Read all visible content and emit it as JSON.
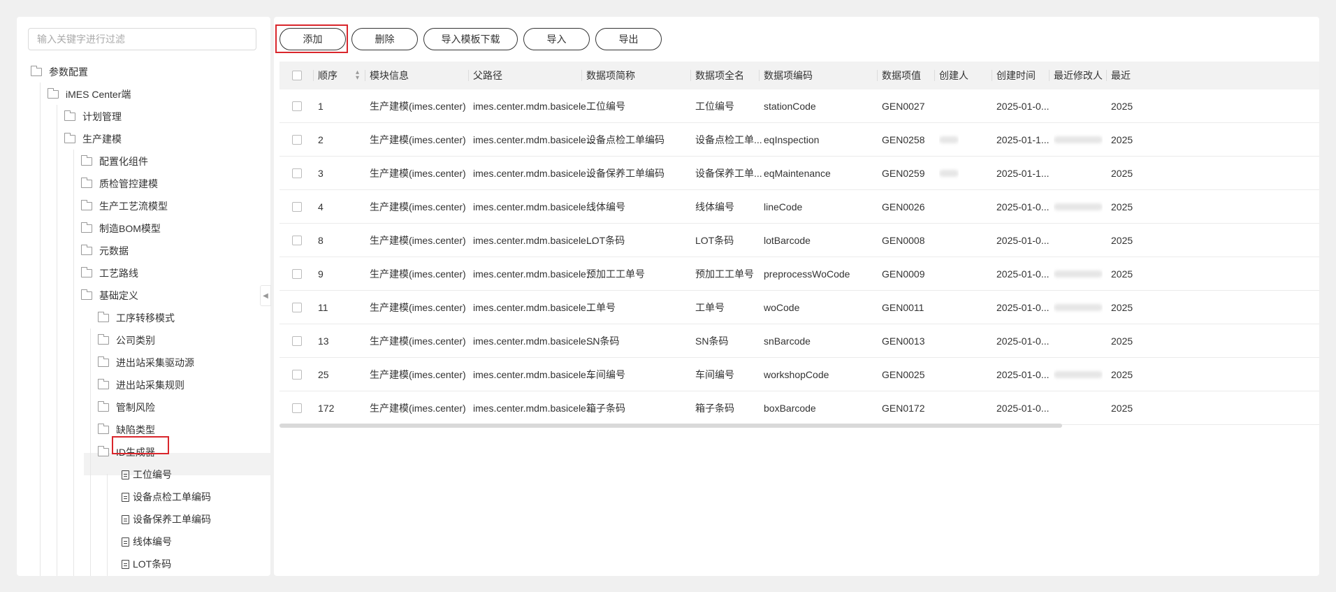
{
  "filter": {
    "placeholder": "输入关键字进行过滤"
  },
  "tree": [
    {
      "label": "参数配置",
      "icon": "folder-icon",
      "depth": 0
    },
    {
      "label": "iMES Center端",
      "icon": "folder-icon",
      "depth": 1
    },
    {
      "label": "计划管理",
      "icon": "folder-icon",
      "depth": 2
    },
    {
      "label": "生产建模",
      "icon": "folder-icon",
      "depth": 2
    },
    {
      "label": "配置化组件",
      "icon": "folder-icon",
      "depth": 3
    },
    {
      "label": "质检管控建模",
      "icon": "folder-icon",
      "depth": 3
    },
    {
      "label": "生产工艺流模型",
      "icon": "folder-icon",
      "depth": 3
    },
    {
      "label": "制造BOM模型",
      "icon": "folder-icon",
      "depth": 3
    },
    {
      "label": "元数据",
      "icon": "folder-icon",
      "depth": 3
    },
    {
      "label": "工艺路线",
      "icon": "folder-icon",
      "depth": 3
    },
    {
      "label": "基础定义",
      "icon": "folder-icon",
      "depth": 3
    },
    {
      "label": "工序转移模式",
      "icon": "folder-icon",
      "depth": 4
    },
    {
      "label": "公司类别",
      "icon": "folder-icon",
      "depth": 4
    },
    {
      "label": "进出站采集驱动源",
      "icon": "folder-icon",
      "depth": 4
    },
    {
      "label": "进出站采集规则",
      "icon": "folder-icon",
      "depth": 4
    },
    {
      "label": "管制风险",
      "icon": "folder-icon",
      "depth": 4
    },
    {
      "label": "缺陷类型",
      "icon": "folder-icon",
      "depth": 4
    },
    {
      "label": "ID生成器",
      "icon": "folder-icon",
      "depth": 4
    },
    {
      "label": "工位编号",
      "icon": "document-icon",
      "depth": 5
    },
    {
      "label": "设备点检工单编码",
      "icon": "document-icon",
      "depth": 5
    },
    {
      "label": "设备保养工单编码",
      "icon": "document-icon",
      "depth": 5
    },
    {
      "label": "线体编号",
      "icon": "document-icon",
      "depth": 5
    },
    {
      "label": "LOT条码",
      "icon": "document-icon",
      "depth": 5
    }
  ],
  "toolbar": {
    "add": "添加",
    "delete": "删除",
    "template": "导入模板下载",
    "import": "导入",
    "export": "导出"
  },
  "columns": [
    "顺序",
    "模块信息",
    "父路径",
    "数据项简称",
    "数据项全名",
    "数据项编码",
    "数据项值",
    "创建人",
    "创建时间",
    "最近修改人",
    "最近"
  ],
  "rows": [
    {
      "order": "1",
      "module": "生产建模(imes.center)",
      "path": "imes.center.mdm.basicele...",
      "short": "工位编号",
      "full": "工位编号",
      "code": "stationCode",
      "value": "GEN0027",
      "creator": "",
      "created": "2025-01-0...",
      "modifier": "",
      "modified": "2025"
    },
    {
      "order": "2",
      "module": "生产建模(imes.center)",
      "path": "imes.center.mdm.basicele...",
      "short": "设备点检工单编码",
      "full": "设备点检工单...",
      "code": "eqInspection",
      "value": "GEN0258",
      "creator": "blurred",
      "created": "2025-01-1...",
      "modifier": "blurred",
      "modified": "2025"
    },
    {
      "order": "3",
      "module": "生产建模(imes.center)",
      "path": "imes.center.mdm.basicele...",
      "short": "设备保养工单编码",
      "full": "设备保养工单...",
      "code": "eqMaintenance",
      "value": "GEN0259",
      "creator": "blurred",
      "created": "2025-01-1...",
      "modifier": "",
      "modified": "2025"
    },
    {
      "order": "4",
      "module": "生产建模(imes.center)",
      "path": "imes.center.mdm.basicele...",
      "short": "线体编号",
      "full": "线体编号",
      "code": "lineCode",
      "value": "GEN0026",
      "creator": "",
      "created": "2025-01-0...",
      "modifier": "blurred",
      "modified": "2025"
    },
    {
      "order": "8",
      "module": "生产建模(imes.center)",
      "path": "imes.center.mdm.basicele...",
      "short": "LOT条码",
      "full": "LOT条码",
      "code": "lotBarcode",
      "value": "GEN0008",
      "creator": "",
      "created": "2025-01-0...",
      "modifier": "",
      "modified": "2025"
    },
    {
      "order": "9",
      "module": "生产建模(imes.center)",
      "path": "imes.center.mdm.basicele...",
      "short": "预加工工单号",
      "full": "预加工工单号",
      "code": "preprocessWoCode",
      "value": "GEN0009",
      "creator": "",
      "created": "2025-01-0...",
      "modifier": "blurred",
      "modified": "2025"
    },
    {
      "order": "11",
      "module": "生产建模(imes.center)",
      "path": "imes.center.mdm.basicele...",
      "short": "工单号",
      "full": "工单号",
      "code": "woCode",
      "value": "GEN0011",
      "creator": "",
      "created": "2025-01-0...",
      "modifier": "blurred",
      "modified": "2025"
    },
    {
      "order": "13",
      "module": "生产建模(imes.center)",
      "path": "imes.center.mdm.basicele...",
      "short": "SN条码",
      "full": "SN条码",
      "code": "snBarcode",
      "value": "GEN0013",
      "creator": "",
      "created": "2025-01-0...",
      "modifier": "",
      "modified": "2025"
    },
    {
      "order": "25",
      "module": "生产建模(imes.center)",
      "path": "imes.center.mdm.basicele...",
      "short": "车间编号",
      "full": "车间编号",
      "code": "workshopCode",
      "value": "GEN0025",
      "creator": "",
      "created": "2025-01-0...",
      "modifier": "blurred",
      "modified": "2025"
    },
    {
      "order": "172",
      "module": "生产建模(imes.center)",
      "path": "imes.center.mdm.basicele...",
      "short": "箱子条码",
      "full": "箱子条码",
      "code": "boxBarcode",
      "value": "GEN0172",
      "creator": "",
      "created": "2025-01-0...",
      "modifier": "",
      "modified": "2025"
    }
  ],
  "colors": {
    "highlight": "#d9262c",
    "header_bg": "#f2f2f2",
    "page_bg": "#f0f0f0"
  }
}
